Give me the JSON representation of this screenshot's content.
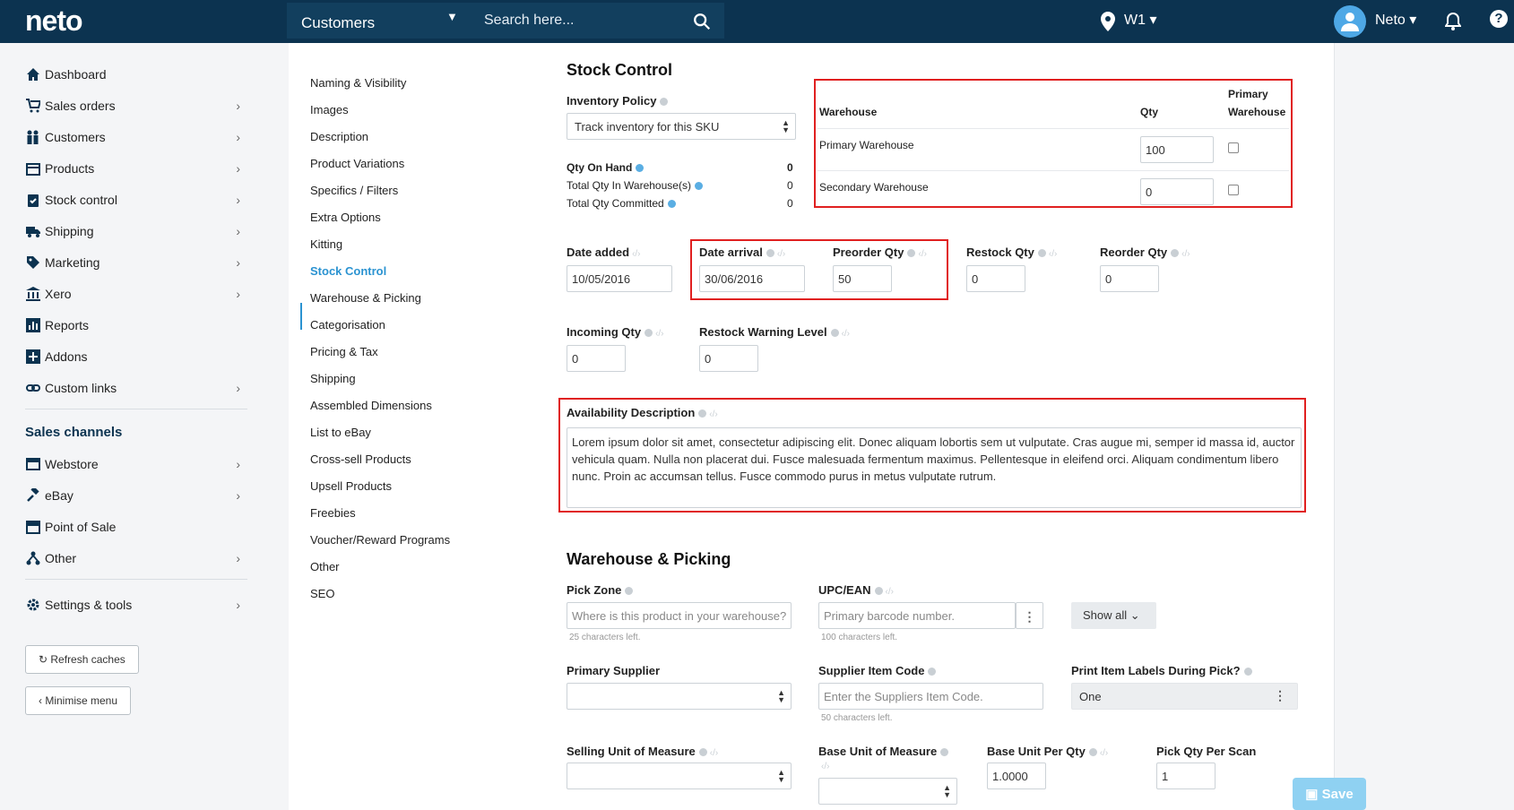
{
  "topbar": {
    "logo": "neto",
    "search_scope": "Customers",
    "search_placeholder": "Search here...",
    "location": "W1 ▾",
    "user": "Neto ▾"
  },
  "sidebar": {
    "items": [
      {
        "label": "Dashboard",
        "icon": "home-icon"
      },
      {
        "label": "Sales orders",
        "icon": "cart-icon"
      },
      {
        "label": "Customers",
        "icon": "people-icon"
      },
      {
        "label": "Products",
        "icon": "box-icon"
      },
      {
        "label": "Stock control",
        "icon": "clipboard-icon"
      },
      {
        "label": "Shipping",
        "icon": "truck-icon"
      },
      {
        "label": "Marketing",
        "icon": "tag-icon"
      },
      {
        "label": "Xero",
        "icon": "bank-icon"
      },
      {
        "label": "Reports",
        "icon": "chart-icon"
      },
      {
        "label": "Addons",
        "icon": "plus-icon"
      },
      {
        "label": "Custom links",
        "icon": "link-icon"
      }
    ],
    "sales_channels_heading": "Sales channels",
    "channels": [
      {
        "label": "Webstore",
        "icon": "window-icon"
      },
      {
        "label": "eBay",
        "icon": "gavel-icon"
      },
      {
        "label": "Point of Sale",
        "icon": "store-icon"
      },
      {
        "label": "Other",
        "icon": "network-icon"
      }
    ],
    "settings": "Settings & tools",
    "refresh": "Refresh caches",
    "minimise": "Minimise menu"
  },
  "section_nav": [
    "Naming & Visibility",
    "Images",
    "Description",
    "Product Variations",
    "Specifics / Filters",
    "Extra Options",
    "Kitting",
    "Stock Control",
    "Warehouse & Picking",
    "Categorisation",
    "Pricing & Tax",
    "Shipping",
    "Assembled Dimensions",
    "List to eBay",
    "Cross-sell Products",
    "Upsell Products",
    "Freebies",
    "Voucher/Reward Programs",
    "Other",
    "SEO"
  ],
  "stock": {
    "title": "Stock Control",
    "inventory_policy_label": "Inventory Policy",
    "inventory_policy_value": "Track inventory for this SKU",
    "qty_on_hand_label": "Qty On Hand",
    "qty_on_hand": "0",
    "total_in_wh_label": "Total Qty In Warehouse(s)",
    "total_in_wh": "0",
    "total_committed_label": "Total Qty Committed",
    "total_committed": "0",
    "warehouse_header": "Warehouse",
    "qty_header": "Qty",
    "primary_wh_header_1": "Primary",
    "primary_wh_header_2": "Warehouse",
    "warehouses": [
      {
        "name": "Primary Warehouse",
        "qty": "100"
      },
      {
        "name": "Secondary Warehouse",
        "qty": "0"
      }
    ],
    "date_added_label": "Date added",
    "date_added": "10/05/2016",
    "date_arrival_label": "Date arrival",
    "date_arrival": "30/06/2016",
    "preorder_label": "Preorder Qty",
    "preorder": "50",
    "restock_label": "Restock Qty",
    "restock": "0",
    "reorder_label": "Reorder Qty",
    "reorder": "0",
    "incoming_label": "Incoming Qty",
    "incoming": "0",
    "warning_label": "Restock Warning Level",
    "warning": "0",
    "avail_label": "Availability Description",
    "avail_text": "Lorem ipsum dolor sit amet, consectetur adipiscing elit. Donec aliquam lobortis sem ut vulputate. Cras augue mi, semper id massa id, auctor vehicula quam. Nulla non placerat dui. Fusce malesuada fermentum maximus. Pellentesque in eleifend orci. Aliquam condimentum libero nunc. Proin ac accumsan tellus. Fusce commodo purus in metus vulputate rutrum."
  },
  "warehouse": {
    "title": "Warehouse & Picking",
    "pick_zone_label": "Pick Zone",
    "pick_zone_placeholder": "Where is this product in your warehouse?",
    "pick_zone_hint": "25 characters left.",
    "upc_label": "UPC/EAN",
    "upc_placeholder": "Primary barcode number.",
    "upc_hint": "100 characters left.",
    "show_all": "Show all",
    "supplier_label": "Primary Supplier",
    "supplier_code_label": "Supplier Item Code",
    "supplier_code_placeholder": "Enter the Suppliers Item Code.",
    "supplier_code_hint": "50 characters left.",
    "print_labels_label": "Print Item Labels During Pick?",
    "print_labels_value": "One",
    "selling_uom_label": "Selling Unit of Measure",
    "base_uom_label": "Base Unit of Measure",
    "base_per_qty_label": "Base Unit Per Qty",
    "base_per_qty": "1.0000",
    "pick_per_scan_label": "Pick Qty Per Scan",
    "pick_per_scan": "1"
  },
  "save_label": "Save"
}
